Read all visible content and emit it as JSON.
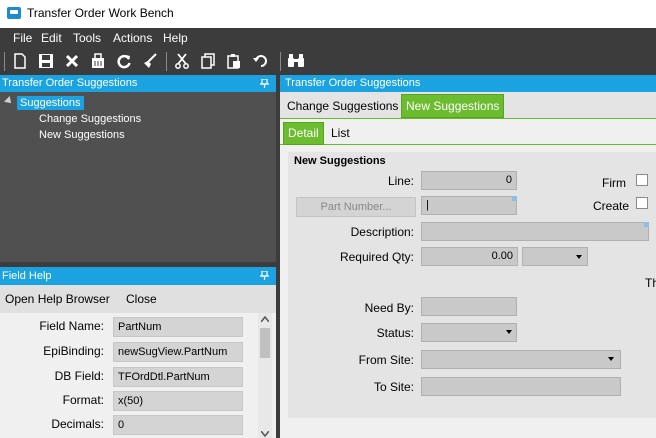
{
  "window": {
    "title": "Transfer Order Work Bench"
  },
  "menu": [
    "File",
    "Edit",
    "Tools",
    "Actions",
    "Help"
  ],
  "toolbar": {
    "icons": [
      "new-icon",
      "save-icon",
      "delete-icon",
      "clear-icon",
      "refresh-icon",
      "clear-form-icon",
      "cut-icon",
      "copy-icon",
      "paste-icon",
      "undo-icon",
      "search-binoculars-icon"
    ]
  },
  "left_panel": {
    "title": "Transfer Order Suggestions",
    "tree": {
      "root": "Suggestions",
      "children": [
        "Change Suggestions",
        "New Suggestions"
      ]
    }
  },
  "field_help": {
    "title": "Field Help",
    "actions": {
      "open_help_browser": "Open Help Browser",
      "close": "Close"
    },
    "rows": [
      {
        "label": "Field Name:",
        "value": "PartNum"
      },
      {
        "label": "EpiBinding:",
        "value": "newSugView.PartNum"
      },
      {
        "label": "DB Field:",
        "value": "TFOrdDtl.PartNum"
      },
      {
        "label": "Format:",
        "value": "x(50)"
      },
      {
        "label": "Decimals:",
        "value": "0"
      }
    ]
  },
  "right_panel": {
    "title": "Transfer Order Suggestions",
    "tabs": [
      {
        "label": "Change Suggestions",
        "active": false
      },
      {
        "label": "New Suggestions",
        "active": true
      }
    ],
    "subtabs": [
      {
        "label": "Detail",
        "active": true
      },
      {
        "label": "List",
        "active": false
      }
    ],
    "group_title": "New Suggestions",
    "fields": {
      "line_label": "Line:",
      "line_value": "0",
      "part_number_button": "Part Number...",
      "part_number_value": "|",
      "description_label": "Description:",
      "description_value": "",
      "required_qty_label": "Required Qty:",
      "required_qty_value": "0.00",
      "uom_value": "",
      "truncated_label": "Th",
      "need_by_label": "Need By:",
      "need_by_value": "",
      "status_label": "Status:",
      "status_value": "",
      "from_site_label": "From Site:",
      "from_site_value": "",
      "to_site_label": "To Site:",
      "to_site_value": "",
      "firm_label": "Firm",
      "create_label": "Create",
      "firm_checked": false,
      "create_checked": false
    }
  },
  "colors": {
    "panel_header": "#1aa3e0",
    "active_tab": "#6cbc2f",
    "dark_chrome": "#3c3c3c",
    "tree_bg": "#505050"
  }
}
